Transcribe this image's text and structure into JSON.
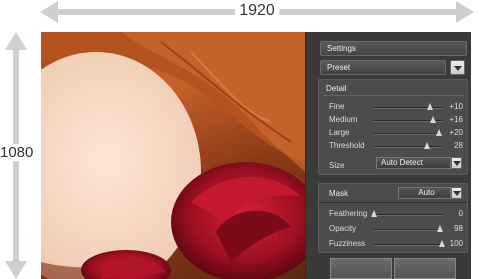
{
  "dimensions": {
    "width_label": "1920",
    "height_label": "1080"
  },
  "panel": {
    "title": "Settings",
    "preset_label": "Preset",
    "detail": {
      "title": "Detail",
      "rows": [
        {
          "label": "Fine",
          "value": "+10",
          "level": 0.82
        },
        {
          "label": "Medium",
          "value": "+16",
          "level": 0.87
        },
        {
          "label": "Large",
          "value": "+20",
          "level": 0.96
        },
        {
          "label": "Threshold",
          "value": "28",
          "level": 0.78
        }
      ],
      "size_label": "Size",
      "size_value": "Auto Detect"
    },
    "mask": {
      "title": "Mask",
      "mode": "Auto",
      "rows": [
        {
          "label": "Feathering",
          "value": "0",
          "level": 0.0
        },
        {
          "label": "Opacity",
          "value": "98",
          "level": 0.97
        },
        {
          "label": "Fuzziness",
          "value": "100",
          "level": 1.0
        }
      ]
    }
  }
}
